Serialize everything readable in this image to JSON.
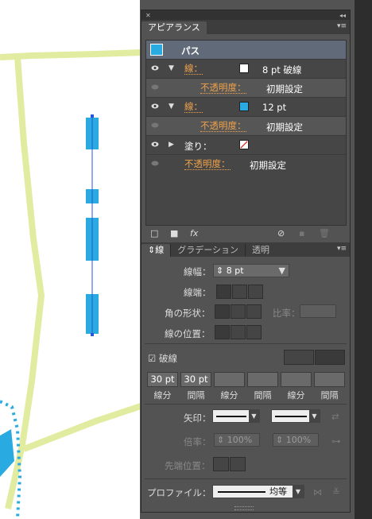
{
  "appearance_panel": {
    "tab_label": "アピアランス",
    "header": "パス",
    "rows": [
      {
        "label": "線：",
        "value": "8 pt 破線"
      },
      {
        "label": "不透明度：",
        "value": "初期設定"
      },
      {
        "label": "線：",
        "value": "12 pt"
      },
      {
        "label": "不透明度：",
        "value": "初期設定"
      },
      {
        "label": "塗り：",
        "value": ""
      },
      {
        "label": "不透明度：",
        "value": "初期設定"
      }
    ],
    "fx_label": "fx"
  },
  "stroke_panel": {
    "tabs": [
      "線",
      "グラデーション",
      "透明"
    ],
    "weight_label": "線幅：",
    "weight_value": "8 pt",
    "cap_label": "線端：",
    "corner_label": "角の形状：",
    "miter_label": "比率：",
    "align_label": "線の位置：",
    "dashed_label": "破線",
    "dash_values": [
      "30 pt",
      "30 pt",
      "",
      "",
      "",
      ""
    ],
    "dash_labels": [
      "線分",
      "間隔",
      "線分",
      "間隔",
      "線分",
      "間隔"
    ],
    "arrow_label": "矢印：",
    "scale_label": "倍率：",
    "scale_value_1": "100%",
    "scale_value_2": "100%",
    "tip_label": "先端位置：",
    "profile_label": "プロファイル：",
    "profile_value": "均等"
  },
  "colors": {
    "accent_cyan": "#29abe2",
    "guide_green": "#e2eca0",
    "label_orange": "#f0a24a"
  }
}
